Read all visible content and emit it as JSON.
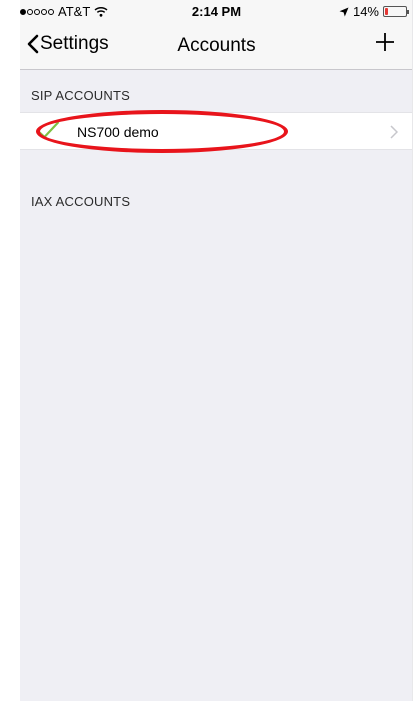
{
  "status_bar": {
    "carrier": "AT&T",
    "signal_bars": 1,
    "time": "2:14 PM",
    "battery": "14%"
  },
  "nav": {
    "back_label": "Settings",
    "title": "Accounts"
  },
  "sections": [
    {
      "header": "SIP ACCOUNTS",
      "items": [
        {
          "label": "NS700 demo",
          "active": true
        }
      ]
    },
    {
      "header": "IAX ACCOUNTS",
      "items": []
    }
  ],
  "colors": {
    "check": "#7dc242",
    "annotation": "#e8141b",
    "background": "#efeff4"
  }
}
